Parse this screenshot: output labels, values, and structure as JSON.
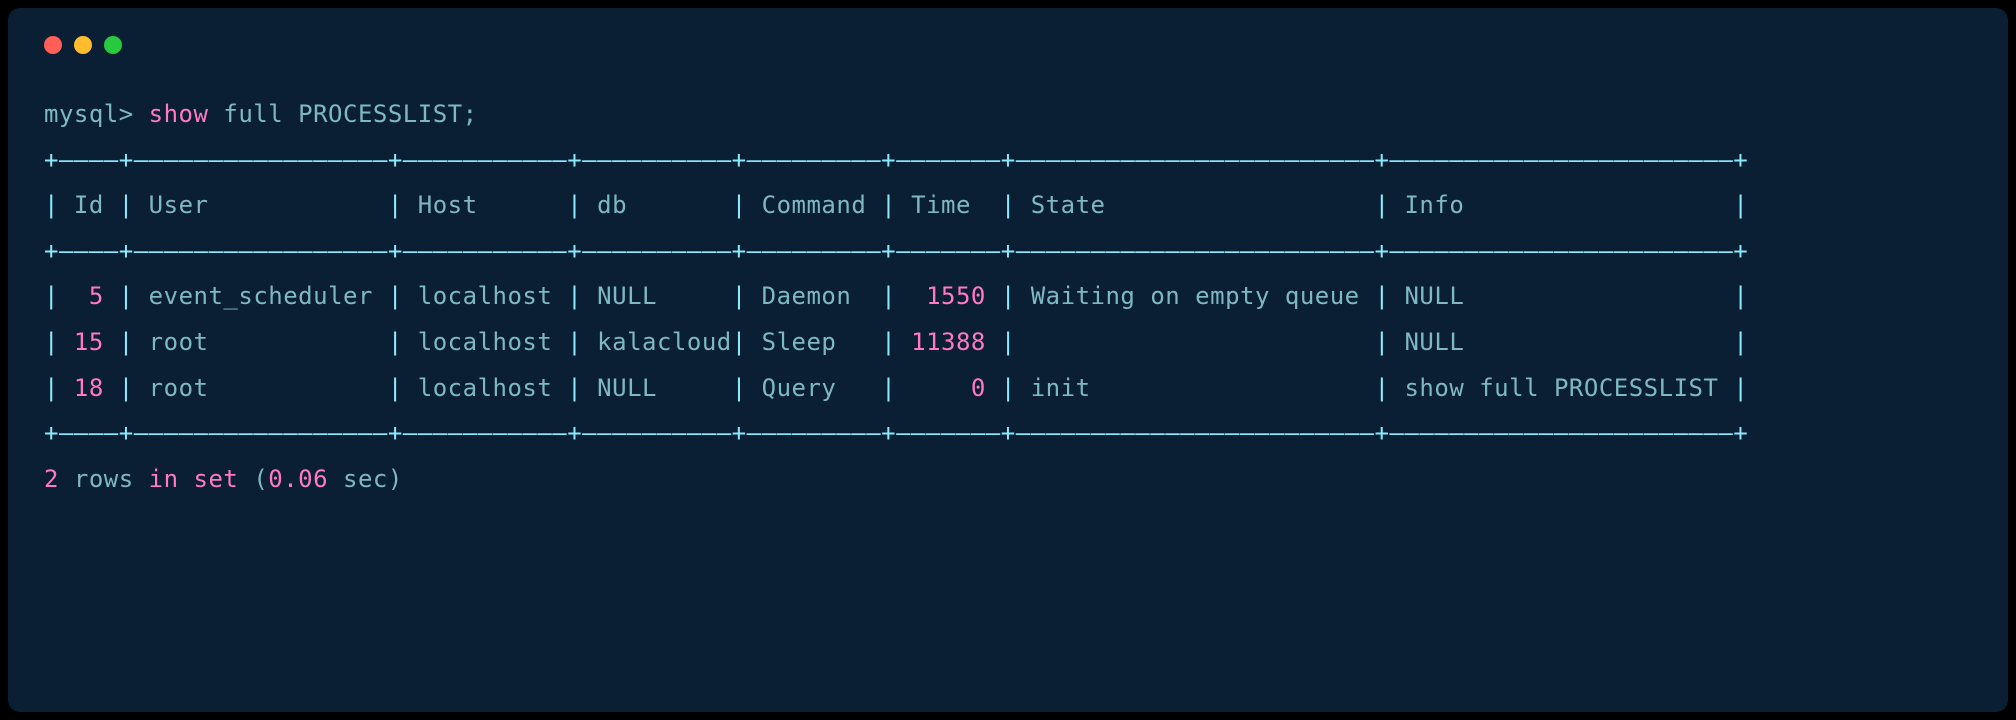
{
  "prompt": "mysql>",
  "command_parts": {
    "show": "show",
    "full": "full",
    "processlist": "PROCESSLIST",
    "semicolon": ";"
  },
  "table": {
    "headers": [
      "Id",
      "User",
      "Host",
      "db",
      "Command",
      "Time",
      "State",
      "Info"
    ],
    "rows": [
      {
        "id": "5",
        "user": "event_scheduler",
        "host": "localhost",
        "db": "NULL",
        "command": "Daemon",
        "time": "1550",
        "state": "Waiting on empty queue",
        "info": "NULL"
      },
      {
        "id": "15",
        "user": "root",
        "host": "localhost",
        "db": "kalacloud",
        "command": "Sleep",
        "time": "11388",
        "state": "",
        "info": "NULL"
      },
      {
        "id": "18",
        "user": "root",
        "host": "localhost",
        "db": "NULL",
        "command": "Query",
        "time": "0",
        "state": "init",
        "info": "show full PROCESSLIST"
      }
    ]
  },
  "footer": {
    "rows_count": "2",
    "rows_text": "rows",
    "in_text": "in",
    "set_text": "set",
    "time_val": "0.06",
    "sec_text": "sec"
  },
  "border_segments": {
    "top": "+————+—————————————————+———————————+——————————+—————————+———————+————————————————————————+———————————————————————+",
    "header": "| Id | User            | Host      | db       | Command | Time  | State                  | Info                  |",
    "divider": "+————+—————————————————+———————————+——————————+—————————+———————+————————————————————————+———————————————————————+",
    "bottom": "+————+—————————————————+———————————+——————————+—————————+———————+————————————————————————+———————————————————————+"
  }
}
